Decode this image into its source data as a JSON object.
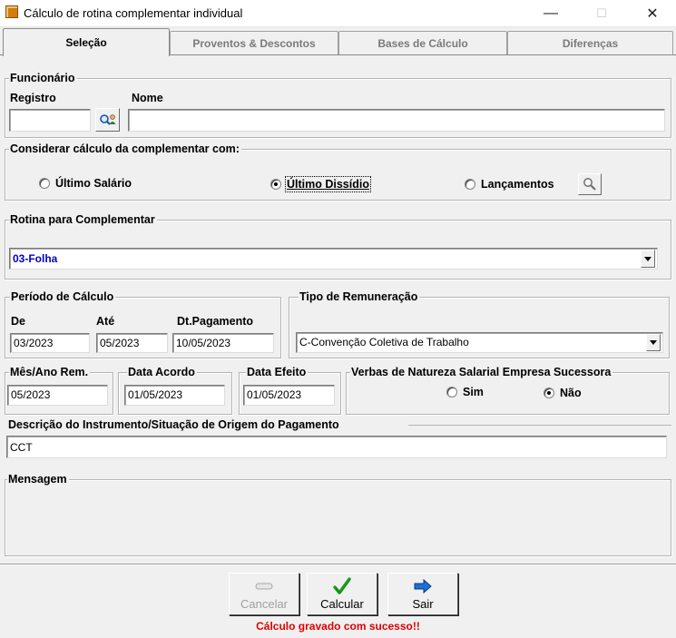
{
  "window": {
    "title": "Cálculo de rotina complementar individual",
    "minimize": "—",
    "maximize": "☐",
    "close": "✕"
  },
  "tabs": [
    {
      "label": "Seleção",
      "active": true
    },
    {
      "label": "Proventos & Descontos",
      "active": false
    },
    {
      "label": "Bases de Cálculo",
      "active": false
    },
    {
      "label": "Diferenças",
      "active": false
    }
  ],
  "funcionario": {
    "group_label": "Funcionário",
    "registro_label": "Registro",
    "nome_label": "Nome",
    "registro_value": "",
    "nome_value": ""
  },
  "considerar": {
    "group_label": "Considerar cálculo da complementar com:",
    "options": [
      {
        "label": "Último Salário",
        "checked": false
      },
      {
        "label": "Último Dissídio",
        "checked": true
      },
      {
        "label": "Lançamentos",
        "checked": false
      }
    ]
  },
  "rotina": {
    "group_label": "Rotina para Complementar",
    "value": "03-Folha"
  },
  "periodo": {
    "group_label": "Período de Cálculo",
    "de_label": "De",
    "ate_label": "Até",
    "pagamento_label": "Dt.Pagamento",
    "de_value": "03/2023",
    "ate_value": "05/2023",
    "pagamento_value": "10/05/2023"
  },
  "remuneracao": {
    "group_label": "Tipo de Remuneração",
    "value": "C-Convenção Coletiva de Trabalho"
  },
  "mes_ano": {
    "group_label": "Mês/Ano Rem.",
    "value": "05/2023"
  },
  "data_acordo": {
    "group_label": "Data Acordo",
    "value": "01/05/2023"
  },
  "data_efeito": {
    "group_label": "Data Efeito",
    "value": "01/05/2023"
  },
  "verbas": {
    "group_label": "Verbas de Natureza Salarial Empresa Sucessora",
    "options": [
      {
        "label": "Sim",
        "checked": false
      },
      {
        "label": "Não",
        "checked": true
      }
    ]
  },
  "descricao": {
    "group_label": "Descrição do Instrumento/Situação de Origem do Pagamento",
    "value": "CCT"
  },
  "mensagem": {
    "group_label": "Mensagem",
    "value": ""
  },
  "buttons": {
    "cancelar": "Cancelar",
    "calcular": "Calcular",
    "sair": "Sair"
  },
  "status": "Cálculo gravado com sucesso!!",
  "colors": {
    "status_red": "#e00000",
    "value_blue": "#0000cc",
    "check_green": "#1aa01a",
    "arrow_blue": "#1e6fd8"
  }
}
